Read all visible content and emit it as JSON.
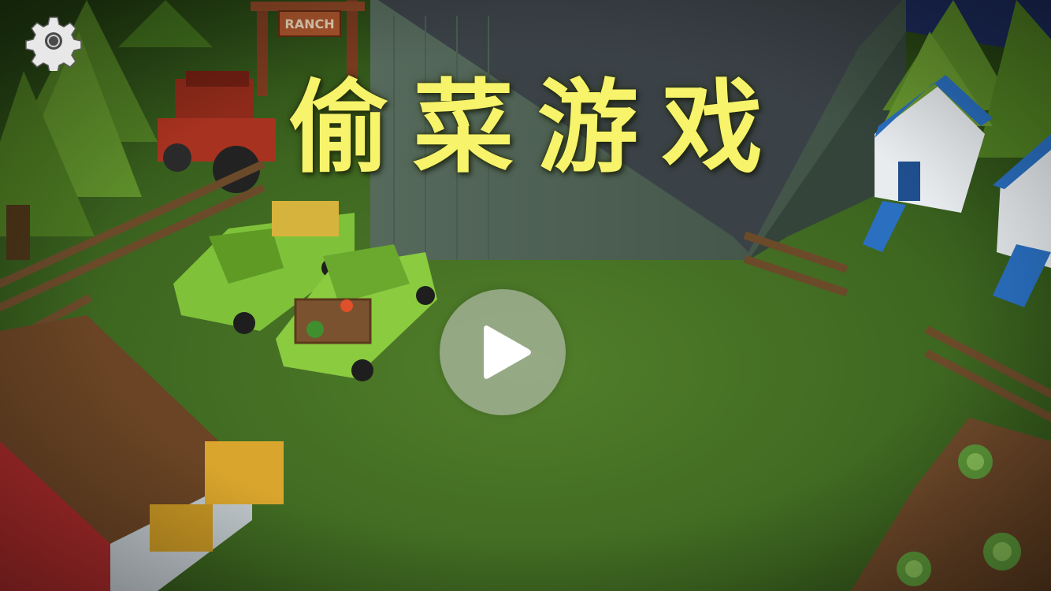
{
  "game": {
    "title": "偷菜游戏",
    "ranch_sign": "RANCH"
  },
  "controls": {
    "settings_icon": "gear-icon",
    "play_icon": "play-icon"
  },
  "colors": {
    "title": "#f7f36a",
    "grass": "#3f6a1f",
    "truck": "#7fc23a",
    "barn_roof": "#3a4248",
    "coop_roof": "#2a6fc0"
  }
}
